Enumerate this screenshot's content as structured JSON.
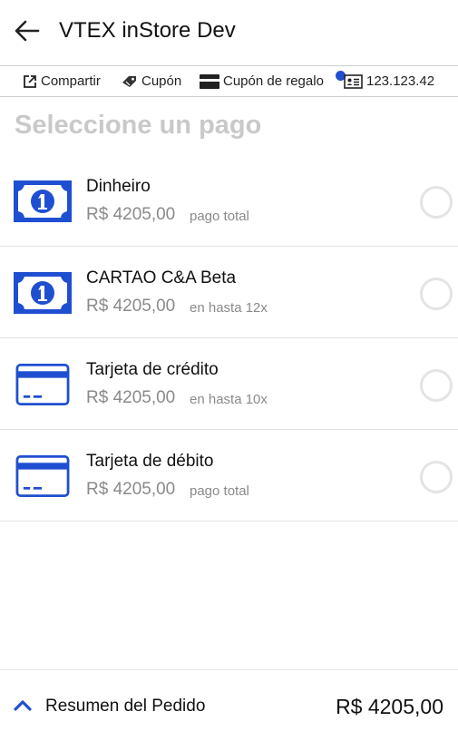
{
  "header": {
    "title": "VTEX inStore Dev"
  },
  "toolbar": {
    "share_label": "Compartir",
    "coupon_label": "Cupón",
    "gift_coupon_label": "Cupón de regalo",
    "customer_id": "123.123.42"
  },
  "section_title": "Seleccione un pago",
  "payments": [
    {
      "name": "Dinheiro",
      "amount": "R$ 4205,00",
      "note": "pago total",
      "icon": "cash-icon"
    },
    {
      "name": "CARTAO C&A Beta",
      "amount": "R$ 4205,00",
      "note": "en hasta 12x",
      "icon": "cash-icon"
    },
    {
      "name": "Tarjeta de crédito",
      "amount": "R$ 4205,00",
      "note": "en hasta 10x",
      "icon": "credit-card-icon"
    },
    {
      "name": "Tarjeta de débito",
      "amount": "R$ 4205,00",
      "note": "pago total",
      "icon": "credit-card-icon"
    }
  ],
  "footer": {
    "label": "Resumen del Pedido",
    "total": "R$ 4205,00"
  },
  "colors": {
    "accent": "#1f4fd1",
    "muted": "#8a8a8a",
    "section_title": "#c9c9c9"
  }
}
